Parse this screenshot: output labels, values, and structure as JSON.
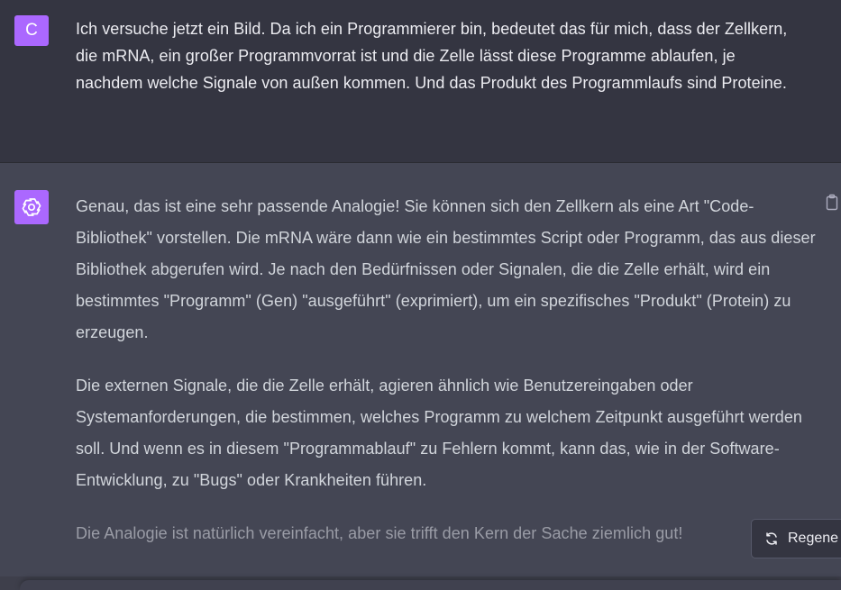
{
  "user_message": {
    "avatar_letter": "C",
    "avatar_color": "#ab68ff",
    "text": "Ich versuche jetzt ein Bild. Da ich ein Programmierer bin, bedeutet das für mich, dass der Zellkern, die mRNA, ein großer Programmvorrat ist und die Zelle lässt diese Programme ablaufen, je nachdem welche Signale von außen kommen. Und das Produkt des Programmlaufs sind Proteine."
  },
  "assistant_message": {
    "avatar_icon": "openai-logo-icon",
    "paragraphs": [
      "Genau, das ist eine sehr passende Analogie! Sie können sich den Zellkern als eine Art \"Code-Bibliothek\" vorstellen. Die mRNA wäre dann wie ein bestimmtes Script oder Programm, das aus dieser Bibliothek abgerufen wird. Je nach den Bedürfnissen oder Signalen, die die Zelle erhält, wird ein bestimmtes \"Programm\" (Gen) \"ausgeführt\" (exprimiert), um ein spezifisches \"Produkt\" (Protein) zu erzeugen.",
      "Die externen Signale, die die Zelle erhält, agieren ähnlich wie Benutzereingaben oder Systemanforderungen, die bestimmen, welches Programm zu welchem Zeitpunkt ausgeführt werden soll. Und wenn es in diesem \"Programmablauf\" zu Fehlern kommt, kann das, wie in der Software-Entwicklung, zu \"Bugs\" oder Krankheiten führen.",
      "Die Analogie ist natürlich vereinfacht, aber sie trifft den Kern der Sache ziemlich gut!"
    ]
  },
  "regenerate_button": {
    "label": "Regene",
    "icon": "refresh-icon"
  },
  "copy_button": {
    "icon": "clipboard-icon"
  },
  "colors": {
    "user_background": "#343541",
    "assistant_background": "#444654",
    "accent": "#ab68ff"
  }
}
